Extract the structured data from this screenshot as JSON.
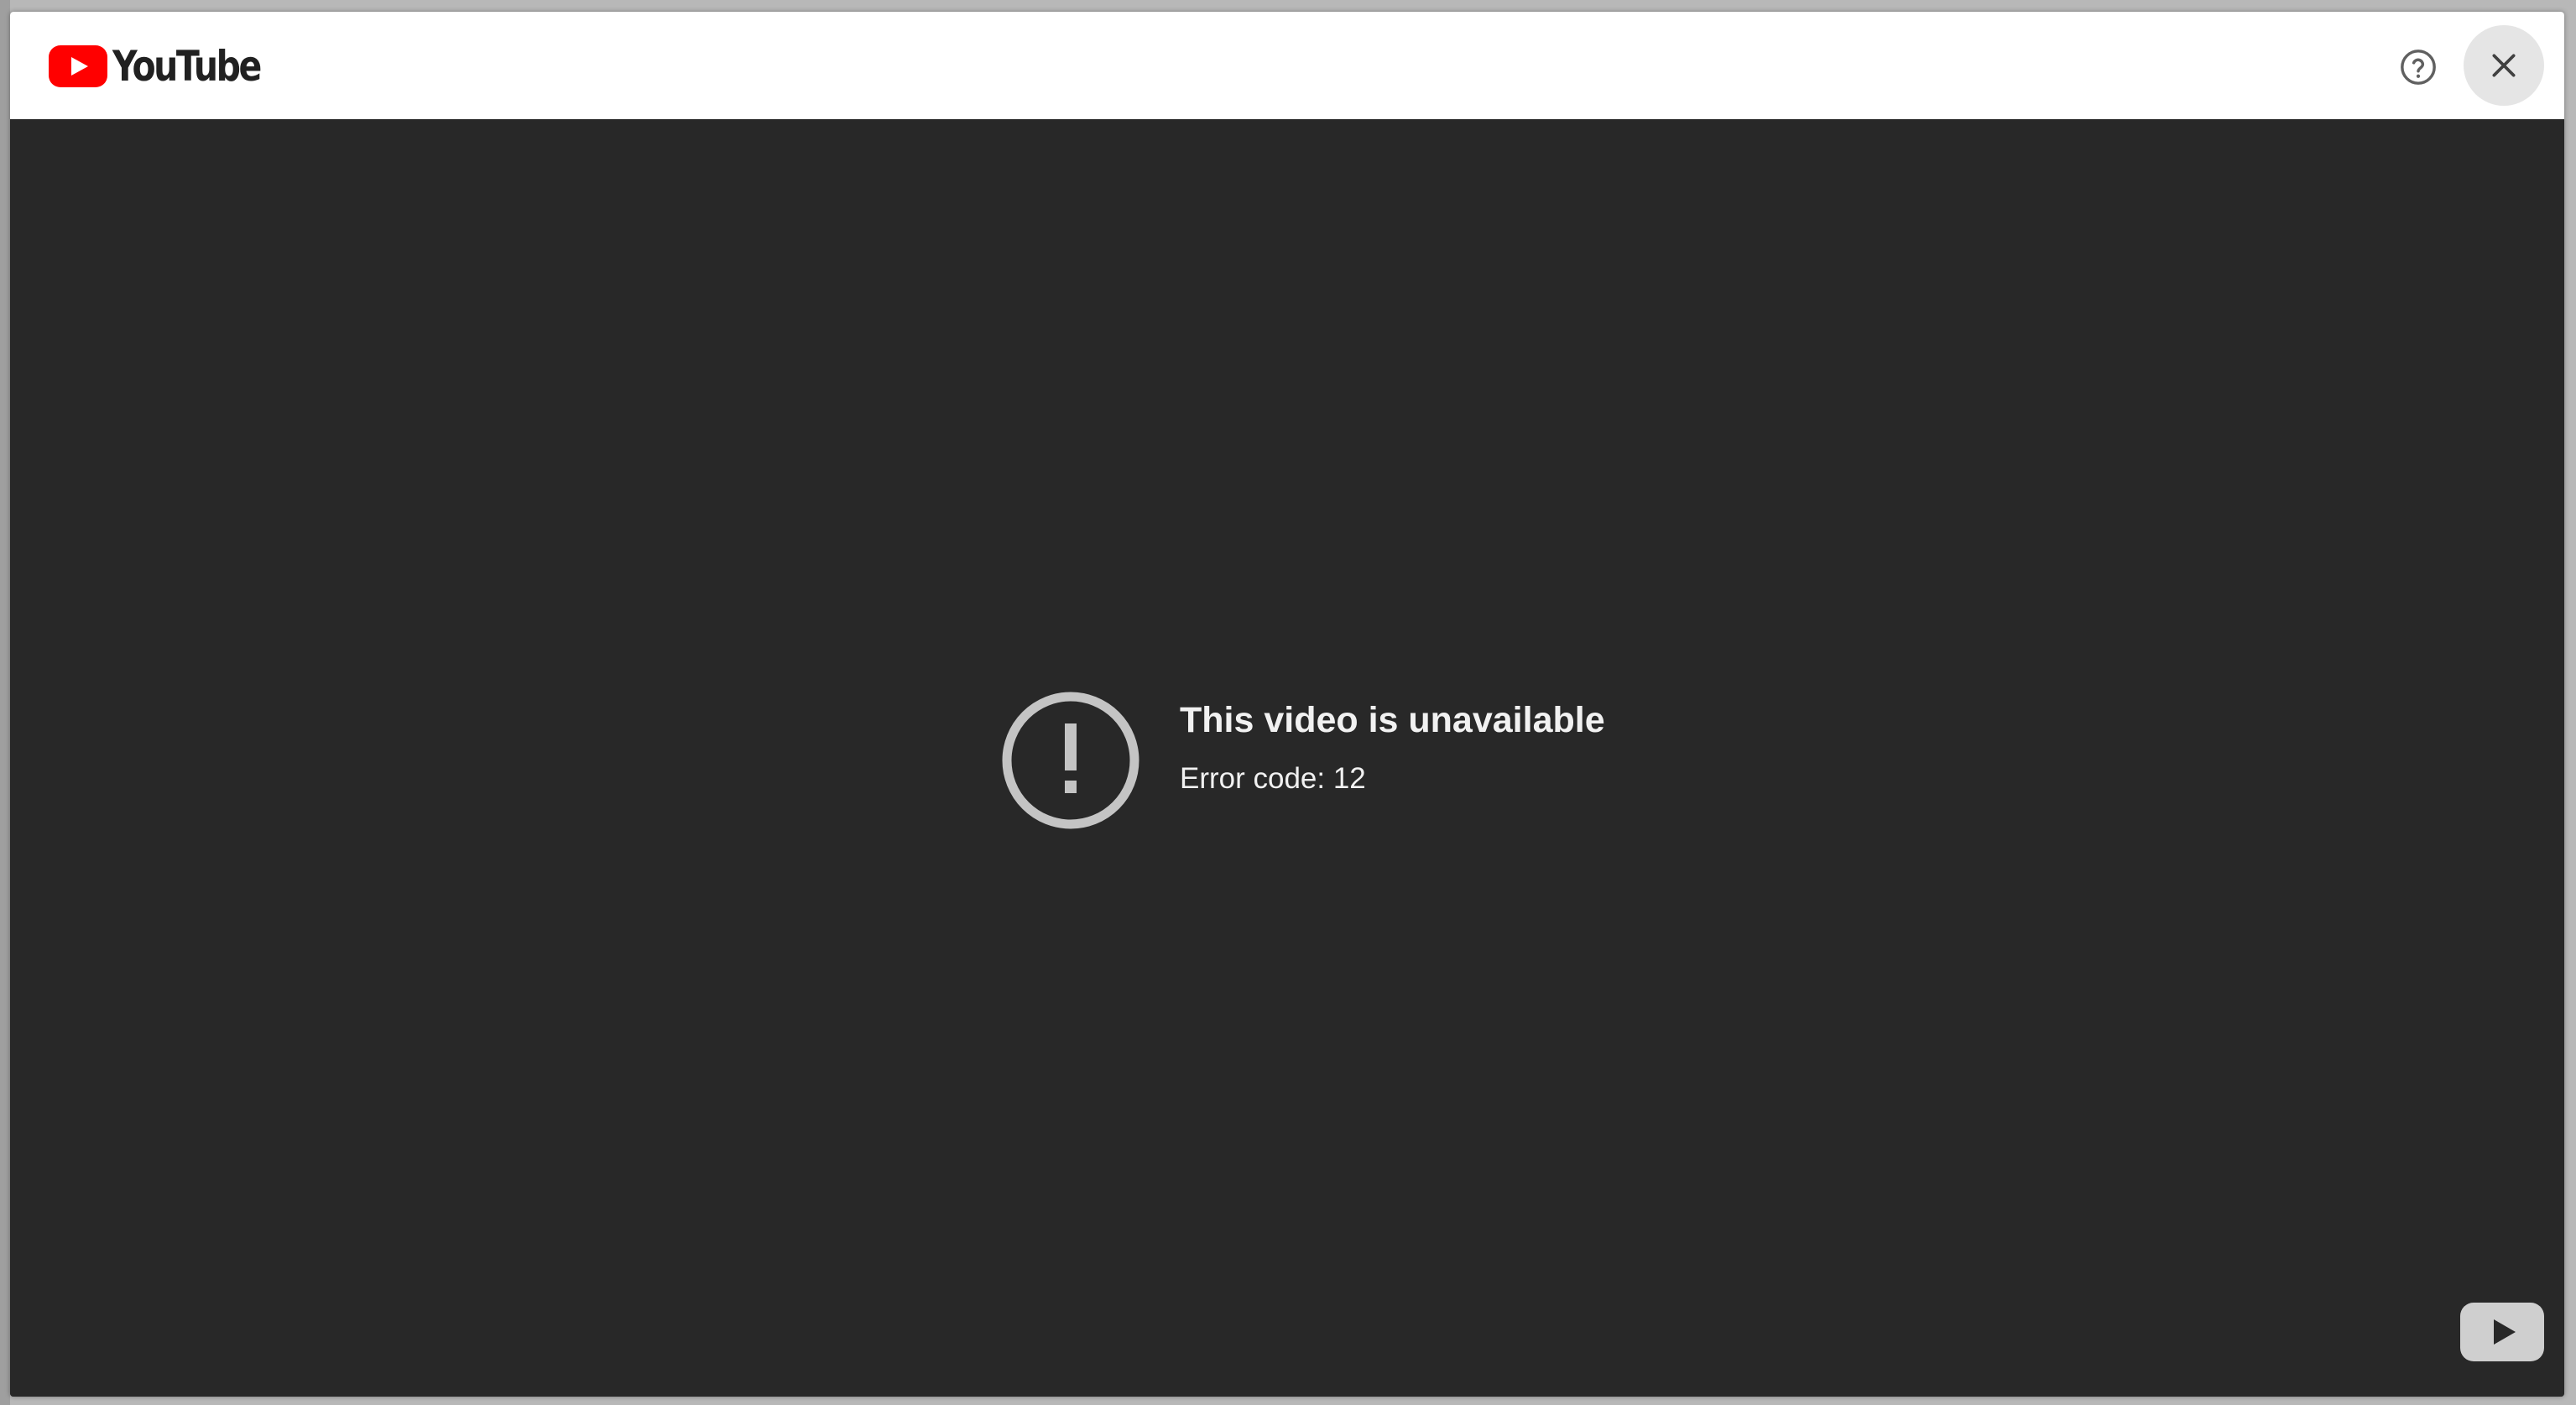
{
  "header": {
    "logo_text": "YouTube",
    "help_icon": "help-circle-icon",
    "close_icon": "close-icon"
  },
  "player": {
    "error_icon": "alert-circle-icon",
    "error_title": "This video is unavailable",
    "error_code": "Error code: 12",
    "watch_icon": "youtube-play-icon"
  },
  "colors": {
    "brand_red": "#ff0000",
    "player_bg": "#282828",
    "header_bg": "#ffffff",
    "error_text": "#f1f1f1",
    "error_icon": "#c4c4c4"
  }
}
